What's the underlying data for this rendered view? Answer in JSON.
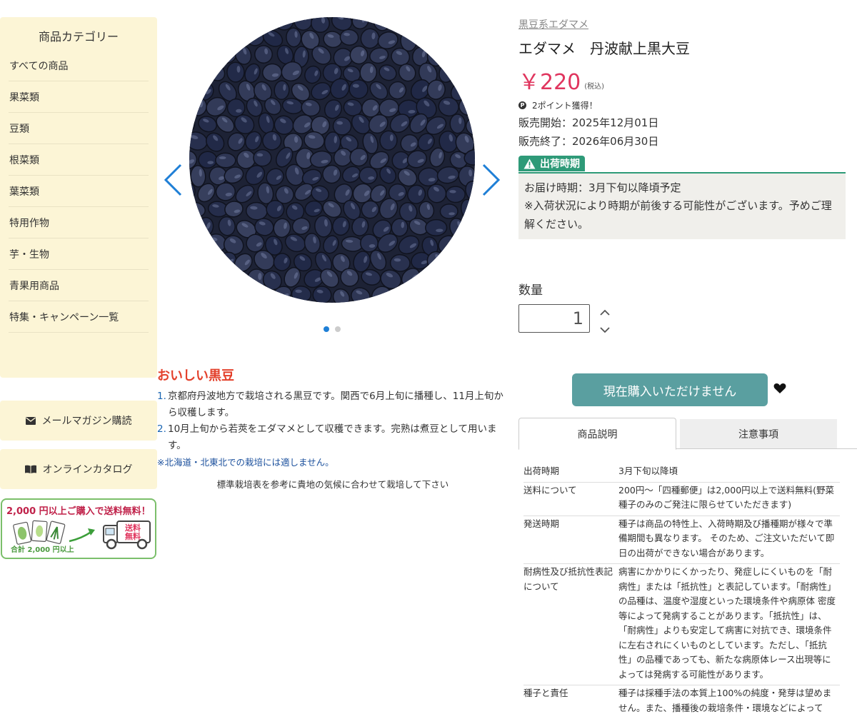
{
  "sidebar": {
    "title": "商品カテゴリー",
    "items": [
      {
        "label": "すべての商品"
      },
      {
        "label": "果菜類"
      },
      {
        "label": "豆類"
      },
      {
        "label": "根菜類"
      },
      {
        "label": "葉菜類"
      },
      {
        "label": "特用作物"
      },
      {
        "label": "芋・生物"
      },
      {
        "label": "青果用商品"
      },
      {
        "label": "特集・キャンペーン一覧"
      }
    ],
    "mail_label": "メールマガジン購読",
    "catalog_label": "オンラインカタログ",
    "banner": {
      "amount": "2,000 円",
      "rest": "以上ご購入で送料無料！",
      "truck_label_1": "送料",
      "truck_label_2": "無料",
      "sub": "合計 2,000 円以上"
    }
  },
  "gallery": {
    "active_index": 0,
    "total": 2
  },
  "description": {
    "title": "おいしい黒豆",
    "points": [
      {
        "num": "1.",
        "text": "京都府丹波地方で栽培される黒豆です。関西で6月上旬に播種し、11月上旬から収穫します。"
      },
      {
        "num": "2.",
        "text": "10月上旬から若莢をエダマメとして収穫できます。完熟は煮豆として用います。"
      }
    ],
    "note": "※北海道・北東北での栽培には適しません。",
    "guide": "標準栽培表を参考に貴地の気候に合わせて栽培して下さい"
  },
  "product": {
    "category": "黒豆系エダマメ",
    "name": "エダマメ　丹波献上黒大豆",
    "price": "￥220",
    "tax": "(税込)",
    "points": "2ポイント獲得！",
    "sale_start": "販売開始：2025年12月01日",
    "sale_end": "販売終了：2026年06月30日",
    "ship_tag": "出荷時期",
    "ship_line1": "お届け時期：3月下旬以降頃予定",
    "ship_line2": "※入荷状況により時期が前後する可能性がございます。予めご理解ください。",
    "qty_label": "数量",
    "qty_value": "1",
    "buy_label": "現在購入いただけません"
  },
  "tabs": [
    {
      "label": "商品説明"
    },
    {
      "label": "注意事項"
    }
  ],
  "spec": [
    {
      "k": "出荷時期",
      "v": "3月下旬以降頃"
    },
    {
      "k": "送料について",
      "v": "200円〜「四種郵便」は2,000円以上で送料無料(野菜種子のみのご発注に限らせていただきます)"
    },
    {
      "k": "発送時期",
      "v": "種子は商品の特性上、入荷時期及び播種期が様々で準備期間も異なります。 そのため、ご注文いただいて即日の出荷ができない場合があります。"
    },
    {
      "k": "耐病性及び抵抗性表記について",
      "v": "病害にかかりにくかったり、発症しにくいものを「耐病性」または「抵抗性」と表記しています。「耐病性」の品種は、温度や湿度といった環境条件や病原体 密度等によって発病することがあります。「抵抗性」は、「耐病性」よりも安定して病害に対抗でき、環境条件に左右されにくいものとしています。ただし、「抵抗性」の品種であっても、新たな病原体レース出現等によっては発病する可能性があります。"
    },
    {
      "k": "種子と責任",
      "v": "種子は採種手法の本質上100%の純度・発芽は望めません。また、播種後の栽培条件・環境などによって"
    }
  ],
  "colors": {
    "sidebar_bg": "#fcf5d6",
    "price": "#e0355e",
    "accent_green": "#2e9a78",
    "buy_button": "#5a9fa0",
    "arrow": "#1f7fd6"
  }
}
